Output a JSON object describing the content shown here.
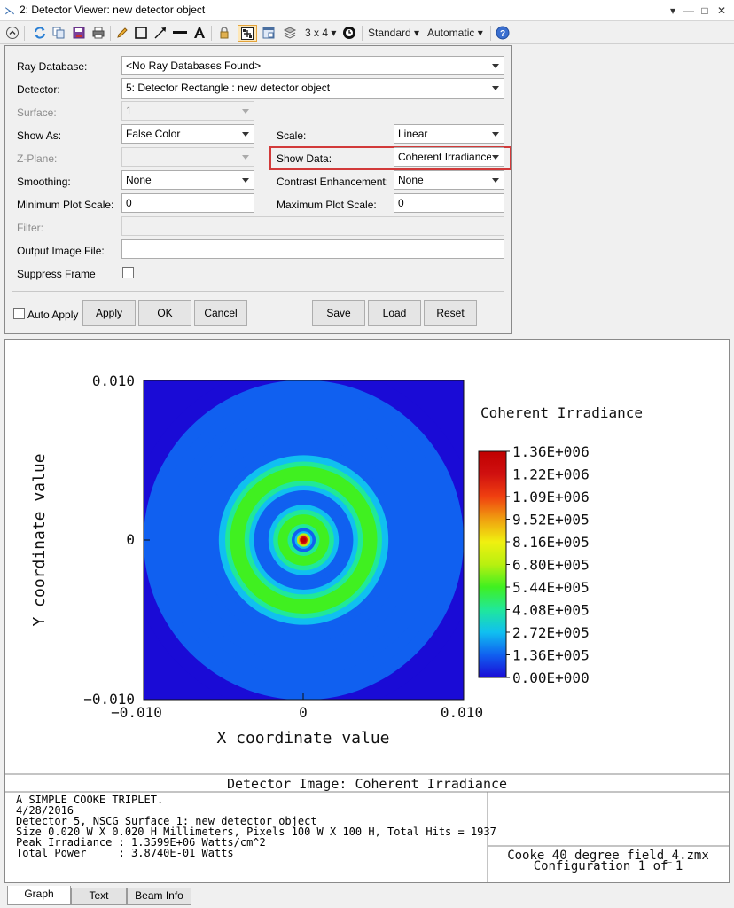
{
  "window": {
    "title": "2: Detector Viewer: new detector object"
  },
  "toolbar": {
    "layout_label": "3 x 4 ▾",
    "standard_label": "Standard ▾",
    "automatic_label": "Automatic ▾"
  },
  "settings": {
    "ray_database_label": "Ray Database:",
    "ray_database_value": "<No Ray Databases Found>",
    "detector_label": "Detector:",
    "detector_value": "5: Detector Rectangle : new detector object",
    "surface_label": "Surface:",
    "surface_value": "1",
    "show_as_label": "Show As:",
    "show_as_value": "False Color",
    "scale_label": "Scale:",
    "scale_value": "Linear",
    "zplane_label": "Z-Plane:",
    "zplane_value": "",
    "show_data_label": "Show Data:",
    "show_data_value": "Coherent Irradiance",
    "smoothing_label": "Smoothing:",
    "smoothing_value": "None",
    "contrast_label": "Contrast Enhancement:",
    "contrast_value": "None",
    "min_plot_label": "Minimum Plot Scale:",
    "min_plot_value": "0",
    "max_plot_label": "Maximum Plot Scale:",
    "max_plot_value": "0",
    "filter_label": "Filter:",
    "filter_value": "",
    "output_label": "Output Image File:",
    "output_value": "",
    "suppress_label": "Suppress Frame",
    "auto_apply_label": "Auto Apply",
    "buttons": {
      "apply": "Apply",
      "ok": "OK",
      "cancel": "Cancel",
      "save": "Save",
      "load": "Load",
      "reset": "Reset"
    }
  },
  "chart_data": {
    "type": "heatmap",
    "title": "Detector Image: Coherent Irradiance",
    "xlabel": "X coordinate value",
    "ylabel": "Y coordinate value",
    "xlim": [
      -0.01,
      0.01
    ],
    "ylim": [
      -0.01,
      0.01
    ],
    "x_ticks": [
      "−0.010",
      "0",
      "0.010"
    ],
    "y_ticks": [
      "0.010",
      "0",
      "−0.010"
    ],
    "colorbar_title": "Coherent Irradiance",
    "colorbar_ticks": [
      "1.36E+006",
      "1.22E+006",
      "1.09E+006",
      "9.52E+005",
      "8.16E+005",
      "6.80E+005",
      "5.44E+005",
      "4.08E+005",
      "2.72E+005",
      "1.36E+005",
      "0.00E+000"
    ],
    "peak_value": 1359900,
    "pattern": "airy-rings",
    "colormap": [
      "#1a0bd6",
      "#1060f0",
      "#10c0f0",
      "#20e89a",
      "#40f020",
      "#b8f010",
      "#f0f010",
      "#f0a010",
      "#f04010",
      "#d01010",
      "#c00000"
    ]
  },
  "info": {
    "lines": [
      "A SIMPLE COOKE TRIPLET.",
      "4/28/2016",
      "Detector 5, NSCG Surface 1: new detector object",
      "Size 0.020 W X 0.020 H Millimeters, Pixels 100 W X 100 H, Total Hits = 1937",
      "Peak Irradiance : 1.3599E+06 Watts/cm^2",
      "Total Power     : 3.8740E-01 Watts"
    ],
    "file_name": "Cooke 40 degree field_4.zmx",
    "configuration": "Configuration 1 of 1"
  },
  "tabs": {
    "graph": "Graph",
    "text": "Text",
    "beam_info": "Beam Info"
  }
}
